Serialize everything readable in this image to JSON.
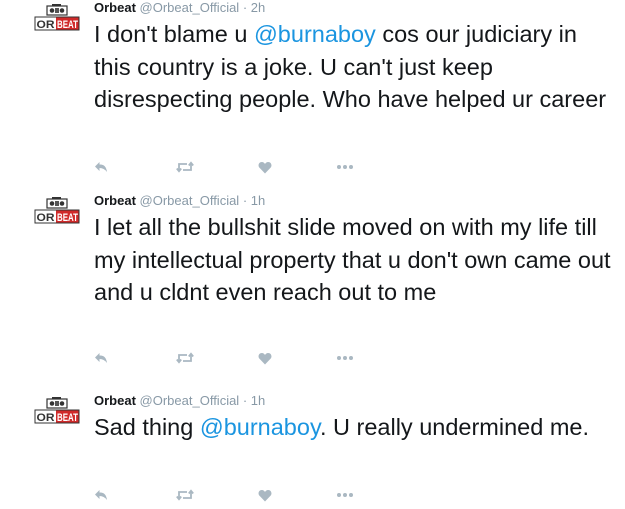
{
  "tweets": [
    {
      "name": "Orbeat",
      "handle": "@Orbeat_Official",
      "separator": "·",
      "time": "2h",
      "text_before": "I don't blame u ",
      "mention": "@burnaboy",
      "text_after": " cos our judiciary in this country is a joke. U can't just keep disrespecting people. Who have helped ur career"
    },
    {
      "name": "Orbeat",
      "handle": "@Orbeat_Official",
      "separator": "·",
      "time": "1h",
      "text": "I let all the bullshit slide moved on with my life till my intellectual property that u don't own came out and u cldnt even reach out to me"
    },
    {
      "name": "Orbeat",
      "handle": "@Orbeat_Official",
      "separator": "·",
      "time": "1h",
      "text_before": "Sad thing ",
      "mention": "@burnaboy",
      "text_after": ". U really undermined me."
    }
  ],
  "avatar_logo_text": "ORBEAT",
  "colors": {
    "text": "#14171a",
    "muted": "#8899a6",
    "mention": "#1b95e0",
    "icon": "#aab8c2",
    "logo_red": "#d02a2a"
  },
  "icons": {
    "reply": "reply-icon",
    "retweet": "retweet-icon",
    "like": "heart-icon",
    "more": "more-icon"
  }
}
